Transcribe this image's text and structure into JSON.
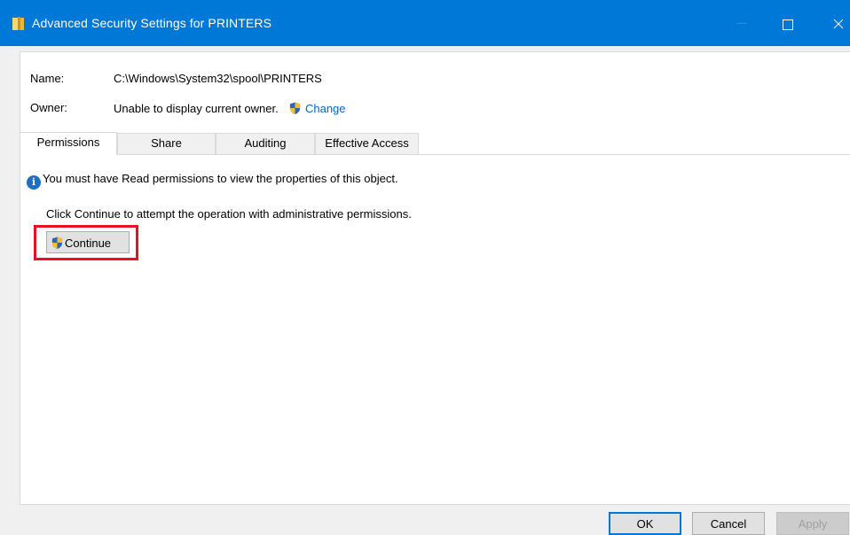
{
  "window": {
    "title": "Advanced Security Settings for PRINTERS",
    "titlebar_color": "#0078d7"
  },
  "details": {
    "name_label": "Name:",
    "name_value": "C:\\Windows\\System32\\spool\\PRINTERS",
    "owner_label": "Owner:",
    "owner_value": "Unable to display current owner.",
    "change_link": "Change"
  },
  "tabs": [
    {
      "label": "Permissions",
      "active": true
    },
    {
      "label": "Share",
      "active": false
    },
    {
      "label": "Auditing",
      "active": false
    },
    {
      "label": "Effective Access",
      "active": false
    }
  ],
  "content": {
    "info_message": "You must have Read permissions to view the properties of this object.",
    "continue_note": "Click Continue to attempt the operation with administrative permissions.",
    "continue_label": "Continue",
    "highlight_color": "#e81123"
  },
  "footer": {
    "ok_label": "OK",
    "cancel_label": "Cancel",
    "apply_label": "Apply"
  },
  "icons": {
    "folder": "folder-icon",
    "shield": "uac-shield-icon",
    "info": "info-icon"
  }
}
